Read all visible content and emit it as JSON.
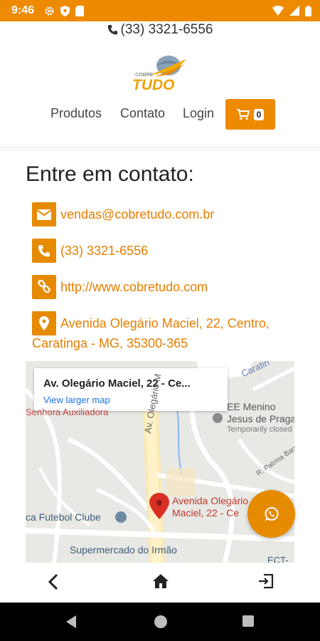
{
  "status_bar": {
    "time": "9:46"
  },
  "header": {
    "phone": "(33) 3321-6556",
    "logo_small": "COBRE",
    "logo_big": "TUDO",
    "nav": {
      "products": "Produtos",
      "contact": "Contato",
      "login": "Login"
    },
    "cart_count": "0"
  },
  "contact": {
    "title": "Entre em contato:",
    "email": "vendas@cobretudo.com.br",
    "phone": "(33) 3321-6556",
    "website": "http://www.cobretudo.com",
    "address_line1": "Avenida Olegário Maciel, 22, Centro,",
    "address_line2": "Caratinga - MG, 35300-365"
  },
  "map": {
    "card_title": "Av. Olegário Maciel, 22 - Ce...",
    "card_link": "View larger map",
    "labels": {
      "senhora": "Senhora Auxiliadora",
      "street_vertical": "Av. Olegário M",
      "caratinga": "Caratin",
      "ee_menino": "EE Menino",
      "jesus_de_praga": "Jesus de Praga",
      "temporarily_closed": "Temporarily closed",
      "r_patrina": "R. Patrina Barr",
      "pin_line1": "Avenida Olegário",
      "pin_line2": "Maciel, 22 - Ce",
      "futebol": "ca Futebol Clube",
      "supermercado": "Supermercado do Irmão",
      "ect": "ECT-"
    }
  },
  "colors": {
    "accent": "#ee8a00",
    "link_blue": "#1a73e8",
    "pin_red": "#d93025"
  },
  "icons": [
    "wifi-icon",
    "signal-icon",
    "battery-icon",
    "phone-icon",
    "cart-icon",
    "envelope-icon",
    "link-icon",
    "map-marker-icon",
    "whatsapp-icon",
    "back-icon",
    "home-icon",
    "exit-icon"
  ]
}
